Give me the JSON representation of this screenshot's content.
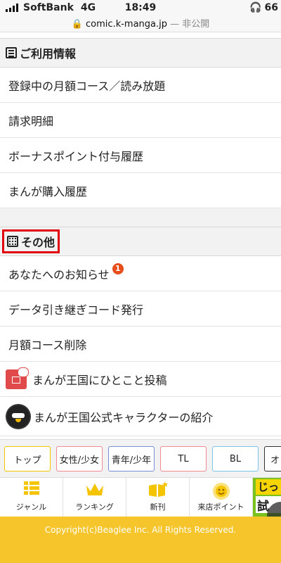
{
  "status_bar": {
    "carrier": "SoftBank",
    "network": "4G",
    "time": "18:49",
    "battery": "66",
    "url": "comic.k-manga.jp",
    "url_suffix": "— 非公開"
  },
  "section_usage": {
    "title": "ご利用情報",
    "items": [
      {
        "label": "登録中の月額コース／読み放題"
      },
      {
        "label": "請求明細"
      },
      {
        "label": "ボーナスポイント付与履歴"
      },
      {
        "label": "まんが購入履歴"
      }
    ]
  },
  "section_other": {
    "title": "その他",
    "items": [
      {
        "label": "あなたへのお知らせ",
        "badge": "1"
      },
      {
        "label": "データ引き継ぎコード発行"
      },
      {
        "label": "月額コース削除"
      },
      {
        "label": "まんが王国にひとこと投稿"
      },
      {
        "label": "まんが王国公式キャラクターの紹介"
      }
    ]
  },
  "genre_tabs": [
    {
      "label": "トップ",
      "color": "#f5c400"
    },
    {
      "label": "女性/少女",
      "color": "#f28a96"
    },
    {
      "label": "青年/少年",
      "color": "#7b8fd8"
    },
    {
      "label": "TL",
      "color": "#f28a96"
    },
    {
      "label": "BL",
      "color": "#7ec4e6"
    },
    {
      "label": "オ",
      "color": "#333333"
    }
  ],
  "bottom_nav": [
    {
      "label": "ジャンル",
      "icon": "genre-list-icon"
    },
    {
      "label": "ランキング",
      "icon": "crown-icon"
    },
    {
      "label": "新刊",
      "icon": "new-book-icon"
    },
    {
      "label": "来店ポイント",
      "icon": "sun-face-icon"
    }
  ],
  "promo": {
    "line1": "じっ",
    "line2": "試"
  },
  "footer": {
    "copyright": "Copyright(c)Beaglee Inc. All Rights Reserved."
  },
  "colors": {
    "accent": "#f5c52b",
    "highlight_box": "#e0000e",
    "badge": "#e84d1c"
  }
}
